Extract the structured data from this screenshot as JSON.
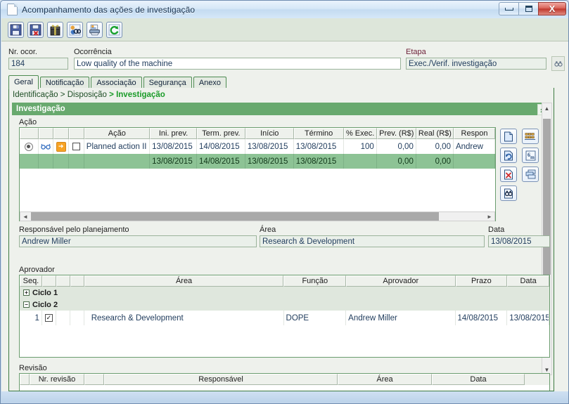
{
  "window": {
    "title": "Acompanhamento das ações de investigação",
    "icon": "document-icon",
    "buttons": {
      "minimize": "─",
      "restore": "❐",
      "close": "X"
    }
  },
  "toolbar": {
    "buttons": [
      {
        "name": "save-button",
        "icon": "floppy-save-icon"
      },
      {
        "name": "save-delete-button",
        "icon": "floppy-delete-icon"
      },
      {
        "name": "attachment-button",
        "icon": "gift-package-icon"
      },
      {
        "name": "search-person-button",
        "icon": "binoculars-person-icon"
      },
      {
        "name": "print-button",
        "icon": "printer-icon"
      },
      {
        "name": "refresh-button",
        "icon": "refresh-icon"
      }
    ]
  },
  "header": {
    "nr_ocor_label": "Nr. ocor.",
    "nr_ocor_value": "184",
    "ocorrencia_label": "Ocorrência",
    "ocorrencia_value": "Low quality of the machine",
    "etapa_label": "Etapa",
    "etapa_value": "Exec./Verif. investigação",
    "etapa_search_icon": "binoculars-icon"
  },
  "tabs": [
    {
      "label": "Geral",
      "active": true
    },
    {
      "label": "Notificação",
      "active": false
    },
    {
      "label": "Associação",
      "active": false
    },
    {
      "label": "Segurança",
      "active": false
    },
    {
      "label": "Anexo",
      "active": false
    }
  ],
  "breadcrumb": {
    "items": [
      "Identificação",
      "Disposição"
    ],
    "separator": ">",
    "current": "Investigação"
  },
  "section": {
    "title": "Investigação",
    "collapse_icon": "chevrons-up-icon"
  },
  "acao": {
    "label": "Ação",
    "columns": [
      "",
      "",
      "",
      "",
      "Ação",
      "Ini. prev.",
      "Term. prev.",
      "Início",
      "Término",
      "% Exec.",
      "Prev. (R$)",
      "Real (R$)",
      "Respon"
    ],
    "rows": [
      {
        "selected_radio": true,
        "glasses_icon": "glasses-icon",
        "status_icon": "orange-arrow-icon",
        "checkbox": false,
        "acao": "Planned action II",
        "ini_prev": "13/08/2015",
        "term_prev": "14/08/2015",
        "inicio": "13/08/2015",
        "termino": "13/08/2015",
        "pct_exec": "100",
        "prev_rs": "0,00",
        "real_rs": "0,00",
        "responsavel": "Andrew"
      },
      {
        "highlighted": true,
        "acao": "",
        "ini_prev": "13/08/2015",
        "term_prev": "14/08/2015",
        "inicio": "13/08/2015",
        "termino": "13/08/2015",
        "pct_exec": "",
        "prev_rs": "0,00",
        "real_rs": "0,00",
        "responsavel": ""
      }
    ],
    "side_buttons": [
      {
        "name": "new-action-button",
        "icon": "new-document-icon"
      },
      {
        "name": "gantt-button",
        "icon": "gantt-chart-icon"
      },
      {
        "name": "reopen-action-button",
        "icon": "document-refresh-icon"
      },
      {
        "name": "six-months-button",
        "icon": "six-m-icon",
        "label": "6m"
      },
      {
        "name": "delete-action-button",
        "icon": "document-delete-icon"
      },
      {
        "name": "copy-action-button",
        "icon": "copy-stack-icon"
      },
      {
        "name": "find-action-button",
        "icon": "binoculars-document-icon"
      }
    ],
    "hscroll": {
      "left_arrow": "◄",
      "right_arrow": "►"
    }
  },
  "planning": {
    "responsavel_label": "Responsável pelo planejamento",
    "responsavel_value": "Andrew Miller",
    "area_label": "Área",
    "area_value": "Research & Development",
    "data_label": "Data",
    "data_value": "13/08/2015"
  },
  "aprovador": {
    "label": "Aprovador",
    "columns": [
      "Seq.",
      "",
      "",
      "",
      "Área",
      "Função",
      "Aprovador",
      "Prazo",
      "Data"
    ],
    "groups": [
      {
        "label": "Ciclo 1",
        "expanded": false,
        "expander": "+"
      },
      {
        "label": "Ciclo 2",
        "expanded": true,
        "expander": "−"
      }
    ],
    "rows": [
      {
        "seq": "1",
        "checkbox": true,
        "area": "Research & Development",
        "funcao": "DOPE",
        "aprovador": "Andrew Miller",
        "prazo": "14/08/2015",
        "data": "13/08/2015"
      }
    ]
  },
  "revisao": {
    "label": "Revisão",
    "columns": [
      "",
      "Nr. revisão",
      "",
      "Responsável",
      "Área",
      "Data"
    ]
  },
  "colors": {
    "section_green": "#68a96e",
    "selected_row_green": "#8dc395",
    "border_green": "#3d7b41",
    "accent_red": "#6e2239",
    "breadcrumb_current": "#1a9b28"
  }
}
